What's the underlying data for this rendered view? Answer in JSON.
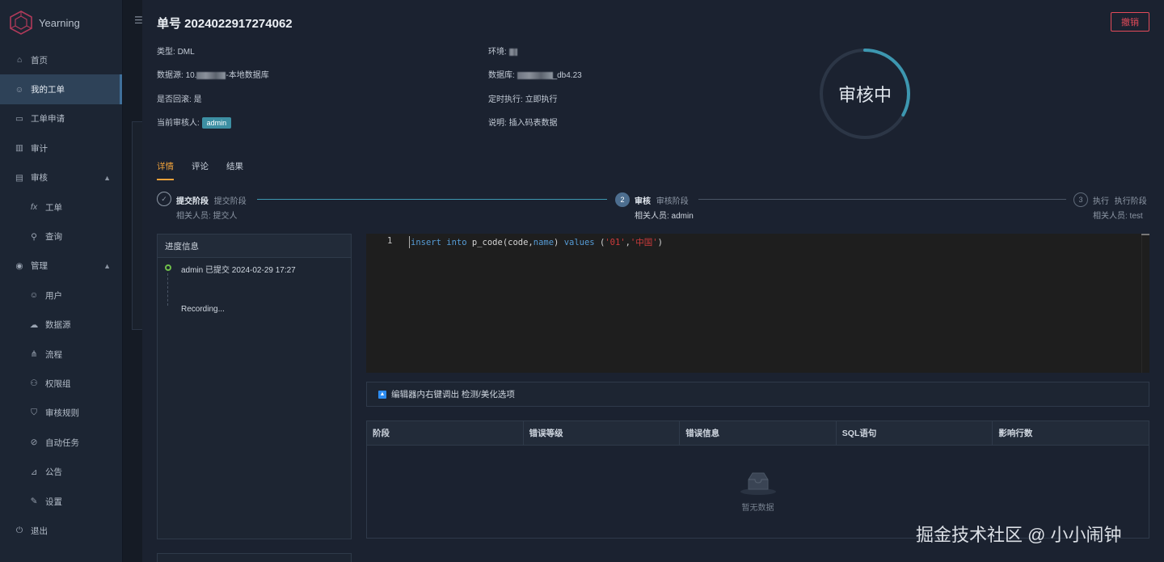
{
  "app": {
    "name": "Yearning"
  },
  "sidebar": {
    "items": [
      {
        "label": "首页",
        "icon": "home-icon"
      },
      {
        "label": "我的工单",
        "icon": "user-icon",
        "active": true
      },
      {
        "label": "工单申请",
        "icon": "monitor-icon"
      },
      {
        "label": "审计",
        "icon": "bar-chart-icon"
      },
      {
        "label": "审核",
        "icon": "audit-icon",
        "expanded": true
      },
      {
        "label": "工单",
        "icon": "function-icon",
        "sub": true
      },
      {
        "label": "查询",
        "icon": "search-icon",
        "sub": true
      },
      {
        "label": "管理",
        "icon": "eye-icon",
        "expanded": true
      },
      {
        "label": "用户",
        "icon": "user-icon",
        "sub": true
      },
      {
        "label": "数据源",
        "icon": "cloud-icon",
        "sub": true
      },
      {
        "label": "流程",
        "icon": "flow-icon",
        "sub": true
      },
      {
        "label": "权限组",
        "icon": "group-icon",
        "sub": true
      },
      {
        "label": "审核规则",
        "icon": "rule-icon",
        "sub": true
      },
      {
        "label": "自动任务",
        "icon": "paperclip-icon",
        "sub": true
      },
      {
        "label": "公告",
        "icon": "chart-icon",
        "sub": true
      },
      {
        "label": "设置",
        "icon": "wrench-icon",
        "sub": true
      },
      {
        "label": "退出",
        "icon": "logout-icon"
      }
    ]
  },
  "order": {
    "title": "单号 2024022917274062",
    "revoke_label": "撤销",
    "type_label": "类型:",
    "type_value": "DML",
    "source_label": "数据源:",
    "source_prefix": "10.",
    "source_suffix": "-本地数据库",
    "rollback_label": "是否回滚:",
    "rollback_value": "是",
    "auditor_label": "当前审核人:",
    "auditor_value": "admin",
    "env_label": "环境:",
    "db_label": "数据库:",
    "db_suffix": "_db4.23",
    "timing_label": "定时执行:",
    "timing_value": "立即执行",
    "desc_label": "说明:",
    "desc_value": "插入码表数据",
    "status_text": "审核中",
    "status_progress": 0.33
  },
  "tabs": [
    {
      "label": "详情",
      "active": true
    },
    {
      "label": "评论"
    },
    {
      "label": "结果"
    }
  ],
  "steps": [
    {
      "title": "提交阶段",
      "subtitle": "提交阶段",
      "desc": "相关人员: 提交人",
      "state": "finished"
    },
    {
      "title": "审核",
      "subtitle": "审核阶段",
      "desc": "相关人员: admin",
      "state": "process",
      "number": "2"
    },
    {
      "title": "执行",
      "subtitle": "执行阶段",
      "desc": "相关人员: test",
      "state": "wait",
      "number": "3"
    }
  ],
  "progress_panel": {
    "header": "进度信息",
    "entries": [
      "admin 已提交 2024-02-29 17:27",
      "Recording..."
    ]
  },
  "editor": {
    "line_number": "1",
    "code": "insert into p_code(code,name) values ('01','中国')"
  },
  "hint": {
    "text": "编辑器内右键调出 检测/美化选项"
  },
  "result_table": {
    "columns": [
      "阶段",
      "错误等级",
      "错误信息",
      "SQL语句",
      "影响行数"
    ],
    "rows": [],
    "empty_text": "暂无数据"
  },
  "watermark": "掘金技术社区 @ 小小闹钟"
}
